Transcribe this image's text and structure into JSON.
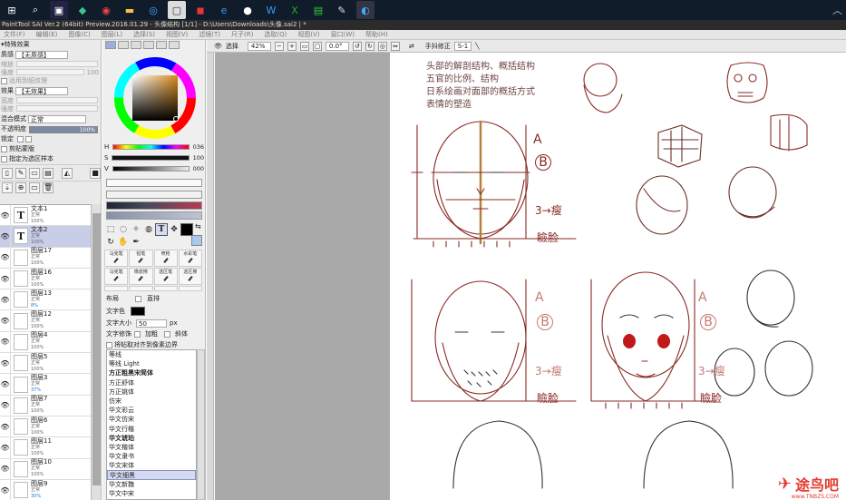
{
  "window": {
    "title": "PaintTool SAI Ver.2 (64bit) Preview.2016.01.29 - 头像结构 [1/1] - D:\\Users\\Downloads\\头像.sai2 | *"
  },
  "menubar": [
    "文件(F)",
    "编辑(E)",
    "图像(C)",
    "图层(L)",
    "选择(S)",
    "视图(V)",
    "滤镜(T)",
    "尺子(R)",
    "选取(Q)",
    "视图(V)",
    "窗口(W)",
    "帮助(H)"
  ],
  "left_panel": {
    "section_title": "特殊效果",
    "texture_label": "质感",
    "texture_value": "【无质感】",
    "texture_scale_label": "缩放",
    "texture_intensity_label": "强度",
    "texture_intensity_value": "100",
    "texture_link_label": "适用到纸纹理",
    "effect_label": "效果",
    "effect_value": "【无效果】",
    "effect_width_label": "宽度",
    "effect_intensity_label": "强度",
    "blend_label": "混合模式",
    "blend_value": "正常",
    "opacity_label": "不透明度",
    "opacity_value": "100%",
    "lock_label": "锁定",
    "clip_label": "剪贴蒙版",
    "selection_source_label": "指定为选区样本"
  },
  "layers": [
    {
      "name": "文本1",
      "mode": "正常",
      "opacity": "100%",
      "text": true,
      "selected": false
    },
    {
      "name": "文本2",
      "mode": "正常",
      "opacity": "100%",
      "text": true,
      "selected": true
    },
    {
      "name": "图层17",
      "mode": "正常",
      "opacity": "100%",
      "text": false,
      "selected": false
    },
    {
      "name": "图层16",
      "mode": "正常",
      "opacity": "100%",
      "text": false,
      "selected": false
    },
    {
      "name": "图层13",
      "mode": "正常",
      "opacity": "8%",
      "text": false,
      "selected": false,
      "low": true
    },
    {
      "name": "图层12",
      "mode": "正常",
      "opacity": "100%",
      "text": false,
      "selected": false
    },
    {
      "name": "图层4",
      "mode": "正常",
      "opacity": "100%",
      "text": false,
      "selected": false
    },
    {
      "name": "图层5",
      "mode": "正常",
      "opacity": "100%",
      "text": false,
      "selected": false
    },
    {
      "name": "图层3",
      "mode": "正常",
      "opacity": "37%",
      "text": false,
      "selected": false,
      "low": true
    },
    {
      "name": "图层7",
      "mode": "正常",
      "opacity": "100%",
      "text": false,
      "selected": false
    },
    {
      "name": "图层6",
      "mode": "正常",
      "opacity": "100%",
      "text": false,
      "selected": false
    },
    {
      "name": "图层11",
      "mode": "正常",
      "opacity": "100%",
      "text": false,
      "selected": false
    },
    {
      "name": "图层10",
      "mode": "正常",
      "opacity": "100%",
      "text": false,
      "selected": false
    },
    {
      "name": "图层9",
      "mode": "正常",
      "opacity": "30%",
      "text": false,
      "selected": false,
      "low": true
    }
  ],
  "color": {
    "h_label": "H",
    "h_value": "036",
    "s_label": "S",
    "s_value": "100",
    "v_label": "V",
    "v_value": "000",
    "current": "#000000"
  },
  "brushes": [
    "马克笔",
    "铅笔",
    "喷枪",
    "水彩笔",
    "马克笔",
    "橡皮擦",
    "选区笔",
    "选区擦",
    "",
    "",
    "",
    ""
  ],
  "text_tool": {
    "layout_label": "布局",
    "vertical_label": "直排",
    "color_label": "文字色",
    "size_label": "文字大小",
    "size_value": "50",
    "size_unit": "px",
    "style_label": "文字修饰",
    "bold_label": "加粗",
    "italic_label": "斜体",
    "align_label": "将帖取对齐到像素边界"
  },
  "fonts": [
    "等线",
    "等线 Light",
    "方正粗黑宋简体",
    "方正舒体",
    "方正姚体",
    "仿宋",
    "华文彩云",
    "华文仿宋",
    "华文行楷",
    "华文琥珀",
    "华文楷体",
    "华文隶书",
    "华文宋体",
    "华文细黑",
    "华文新魏",
    "华文中宋"
  ],
  "selected_font": "华文细黑",
  "canvas_toolbar": {
    "select_label": "选择",
    "zoom_value": "42%",
    "rotate_value": "0.0°",
    "stabilizer_label": "手抖修正",
    "stabilizer_value": "S-1"
  },
  "drawing": {
    "notes": [
      "头部的解剖结构、概括结构",
      "五官的比例、结构",
      "日系绘画对面部的概括方式",
      "表情的塑造"
    ],
    "labels": {
      "a": "A",
      "b": "B",
      "frac": "3",
      "arrow": "→",
      "tilt": "瘦",
      "face": "脸",
      "chin": "瞼脸"
    }
  },
  "watermark": {
    "brand": "途鸟吧",
    "site": "www.TNBZS.COM"
  }
}
